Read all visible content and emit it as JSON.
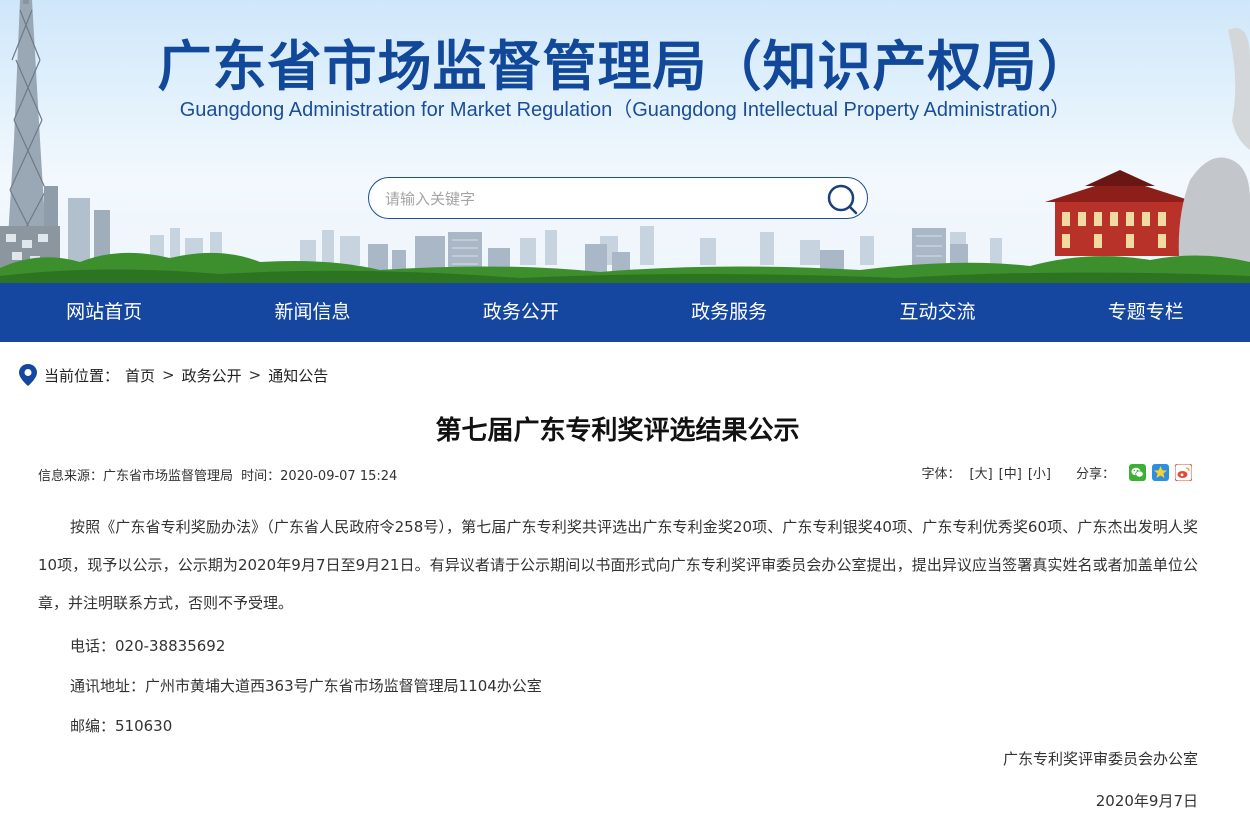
{
  "header": {
    "title": "广东省市场监督管理局（知识产权局）",
    "subtitle": "Guangdong Administration for Market Regulation（Guangdong Intellectual Property Administration）",
    "search_placeholder": "请输入关键字",
    "search_icon": "search-icon"
  },
  "nav": {
    "items": [
      "网站首页",
      "新闻信息",
      "政务公开",
      "政务服务",
      "互动交流",
      "专题专栏"
    ]
  },
  "breadcrumb": {
    "label": "当前位置：",
    "items": [
      "首页",
      "政务公开",
      "通知公告"
    ],
    "separator": ">"
  },
  "article": {
    "title": "第七届广东专利奖评选结果公示",
    "source": "信息来源：广东省市场监督管理局",
    "time": "时间：2020-09-07 15:24",
    "font_label": "字体：",
    "font_sizes": [
      "[大]",
      "[中]",
      "[小]"
    ],
    "share_label": "分享：",
    "share_icons": [
      "wechat-icon",
      "qzone-icon",
      "weibo-icon"
    ],
    "paragraph": "按照《广东省专利奖励办法》（广东省人民政府令258号），第七届广东专利奖共评选出广东专利金奖20项、广东专利银奖40项、广东专利优秀奖60项、广东杰出发明人奖10项，现予以公示，公示期为2020年9月7日至9月21日。有异议者请于公示期间以书面形式向广东专利奖评审委员会办公室提出，提出异议应当签署真实姓名或者加盖单位公章，并注明联系方式，否则不予受理。",
    "phone": "电话：020-38835692",
    "address": "通讯地址：广州市黄埔大道西363号广东省市场监督管理局1104办公室",
    "postcode": "邮编：510630",
    "signature": "广东专利奖评审委员会办公室",
    "date": "2020年9月7日"
  },
  "colors": {
    "brand_blue": "#1547a0",
    "title_blue": "#12489a",
    "wechat_green": "#3cb034",
    "qzone_blue": "#2c8fe0",
    "weibo_red": "#e24a38"
  }
}
